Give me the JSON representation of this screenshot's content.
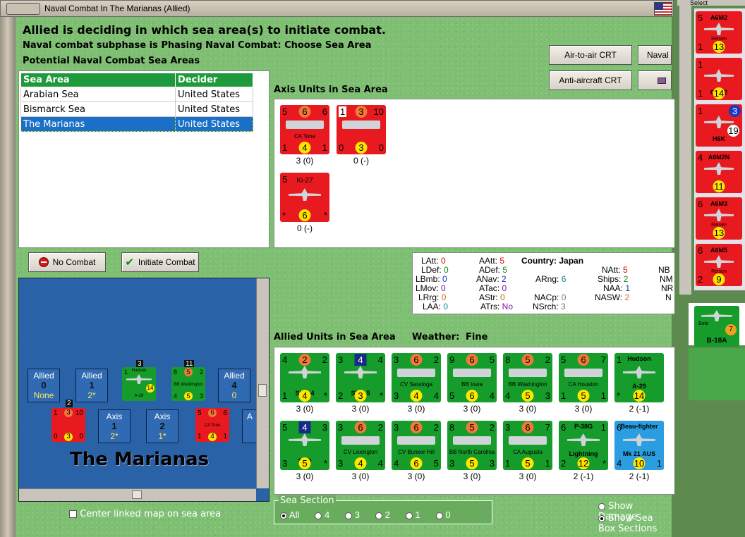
{
  "window": {
    "title": "Naval Combat In The Marianas (Allied)"
  },
  "header": {
    "line1": "Allied is deciding in which sea area(s) to initiate combat.",
    "line2": "Naval combat subphase is Phasing Naval Combat: Choose Sea Area",
    "line3": "Potential Naval Combat Sea Areas"
  },
  "sea_table": {
    "columns": [
      "Sea Area",
      "Decider"
    ],
    "rows": [
      [
        "Arabian Sea",
        "United States"
      ],
      [
        "Bismarck Sea",
        "United States"
      ],
      [
        "The Marianas",
        "United States"
      ]
    ],
    "selected_index": 2
  },
  "crt_buttons": {
    "air_to_air": "Air-to-air CRT",
    "naval": "Naval CRT",
    "anti_aircraft": "Anti-aircraft CRT"
  },
  "axis_section": {
    "label": "Axis Units in Sea Area"
  },
  "axis_units": [
    {
      "name": "CA Tone",
      "tl": "5",
      "tc": "6",
      "tr": "6",
      "bl": "1",
      "bc": "4",
      "br": "1",
      "caption": "3 (0)"
    },
    {
      "name": "",
      "tl": "1",
      "tc": "3",
      "tr": "10",
      "bl": "0",
      "bc": "3",
      "br": "0",
      "caption": "0 (-)"
    },
    {
      "name": "Ki-27",
      "tl": "5",
      "tc": "",
      "tr": "",
      "bl": "*",
      "bc": "6",
      "br": "*",
      "caption": "0 (-)"
    }
  ],
  "combat_buttons": {
    "no_combat": "No Combat",
    "initiate": "Initiate Combat"
  },
  "map": {
    "title": "The Marianas",
    "allied_boxes": [
      {
        "label": "Allied",
        "value": "0",
        "sub": "None"
      },
      {
        "label": "Allied",
        "value": "1",
        "sub": "2*"
      },
      {
        "label": "Allied",
        "value": "4",
        "sub": "0"
      }
    ],
    "axis_boxes": [
      {
        "label": "Axis",
        "value": "1",
        "sub": "2*"
      },
      {
        "label": "Axis",
        "value": "2",
        "sub": "1*"
      },
      {
        "label": "A",
        "value": "",
        "sub": ""
      }
    ],
    "stack_counts": [
      "3",
      "11",
      "2"
    ],
    "mini_counters": [
      {
        "name": "Hudson",
        "tl": "1",
        "tc": "",
        "tr": "",
        "bl": "",
        "bc": "14",
        "br": "",
        "sub": "A-29"
      },
      {
        "name": "BB Washington",
        "tl": "8",
        "tc": "5",
        "tr": "2",
        "bl": "4",
        "bc": "5",
        "br": "3"
      },
      {
        "name": "",
        "tl": "1",
        "tc": "3",
        "tr": "10",
        "bl": "0",
        "bc": "3",
        "br": "0"
      },
      {
        "name": "CA Tone",
        "tl": "5",
        "tc": "6",
        "tr": "6",
        "bl": "1",
        "bc": "4",
        "br": "1"
      }
    ]
  },
  "stats": {
    "LAtt": "0",
    "LDef": "0",
    "LBmb": "0",
    "LMov": "0",
    "LRrg": "0",
    "LAA": "0",
    "AAtt": "5",
    "ADef": "5",
    "ANav": "2",
    "ATac": "0",
    "AStr": "0",
    "ATrs": "No",
    "Country": "Japan",
    "ARng": "6",
    "NACp": "0",
    "NSrch": "3",
    "NAtt": "5",
    "Ships": "2",
    "NAA": "1",
    "NASW": "2",
    "NB_cut": "NB",
    "NM_cut": "NM",
    "NR_cut": "NR",
    "N_cut": "N",
    "labels": {
      "LAtt": "LAtt:",
      "LDef": "LDef:",
      "LBmb": "LBmb:",
      "LMov": "LMov:",
      "LRrg": "LRrg:",
      "LAA": "LAA:",
      "AAtt": "AAtt:",
      "ADef": "ADef:",
      "ANav": "ANav:",
      "ATac": "ATac:",
      "AStr": "AStr:",
      "ATrs": "ATrs:",
      "Country": "Country:",
      "ARng": "ARng:",
      "NACp": "NACp:",
      "NSrch": "NSrch:",
      "NAtt": "NAtt:",
      "Ships": "Ships:",
      "NAA": "NAA:",
      "NASW": "NASW:"
    }
  },
  "allied_section": {
    "label": "Allied Units in Sea Area",
    "weather_label": "Weather:",
    "weather": "Fine"
  },
  "allied_units": [
    {
      "name": "SBD-4",
      "tl": "4",
      "tc": "2",
      "tr": "2",
      "bl": "1",
      "bc": "4",
      "br": "*",
      "caption": "3 (0)",
      "color": "green",
      "tcColor": "#f07838"
    },
    {
      "name": "SBD-5",
      "tl": "3",
      "tc": "4",
      "tr": "4",
      "bl": "2",
      "bc": "3",
      "br": "*",
      "caption": "3 (0)",
      "color": "green",
      "tcColor": "#182a8a"
    },
    {
      "name": "CV Saratoga",
      "tl": "3",
      "tc": "6",
      "tr": "2",
      "bl": "3",
      "bc": "4",
      "br": "4",
      "caption": "3 (0)",
      "color": "green",
      "tcColor": "#f07838"
    },
    {
      "name": "BB Iowa",
      "tl": "9",
      "tc": "6",
      "tr": "5",
      "bl": "5",
      "bc": "6",
      "br": "4",
      "caption": "3 (0)",
      "color": "green",
      "tcColor": "#f07838"
    },
    {
      "name": "BB Washington",
      "tl": "8",
      "tc": "5",
      "tr": "2",
      "bl": "4",
      "bc": "5",
      "br": "3",
      "caption": "3 (0)",
      "color": "green",
      "tcColor": "#f07838"
    },
    {
      "name": "CA Houston",
      "tl": "5",
      "tc": "6",
      "tr": "7",
      "bl": "1",
      "bc": "5",
      "br": "1",
      "caption": "3 (0)",
      "color": "green",
      "tcColor": "#f07838"
    },
    {
      "name": "Hudson",
      "tl": "1",
      "tc": "",
      "tr": "",
      "bl": "*",
      "bc": "14",
      "br": "",
      "sub": "A-29",
      "caption": "2 (-1)",
      "color": "green",
      "tcColor": ""
    },
    {
      "name": "SBD",
      "tl": "5",
      "tc": "4",
      "tr": "3",
      "bl": "3",
      "bc": "5",
      "br": "*",
      "caption": "3 (0)",
      "color": "green",
      "tcColor": "#182a8a"
    },
    {
      "name": "CV Lexington",
      "tl": "3",
      "tc": "6",
      "tr": "2",
      "bl": "3",
      "bc": "4",
      "br": "4",
      "caption": "3 (0)",
      "color": "green",
      "tcColor": "#f07838"
    },
    {
      "name": "CV Bunker Hill",
      "tl": "3",
      "tc": "6",
      "tr": "2",
      "bl": "4",
      "bc": "6",
      "br": "5",
      "caption": "3 (0)",
      "color": "green",
      "tcColor": "#f07838"
    },
    {
      "name": "BB North Carolina",
      "tl": "8",
      "tc": "5",
      "tr": "2",
      "bl": "3",
      "bc": "5",
      "br": "3",
      "caption": "3 (0)",
      "color": "green",
      "tcColor": "#f07838"
    },
    {
      "name": "CA Augusta",
      "tl": "3",
      "tc": "6",
      "tr": "7",
      "bl": "1",
      "bc": "5",
      "br": "1",
      "caption": "3 (0)",
      "color": "green",
      "tcColor": "#f07838"
    },
    {
      "name": "P-38G",
      "tl": "6",
      "tc": "",
      "tr": "1",
      "bl": "2",
      "bc": "12",
      "br": "*",
      "sub": "Lightning",
      "caption": "2 (-1)",
      "color": "green",
      "tcColor": ""
    },
    {
      "name": "Beau-fighter",
      "tl": "6",
      "tc": "",
      "tr": "",
      "bl": "4",
      "bc": "10",
      "br": "1",
      "sub": "Mk 21 AUS",
      "caption": "2 (-1)",
      "color": "blue",
      "tcColor": ""
    }
  ],
  "sea_section": {
    "label": "Sea Section",
    "options": [
      "All",
      "4",
      "3",
      "2",
      "1",
      "0"
    ],
    "selected": "All"
  },
  "options": {
    "center_map": "Center linked map on sea area",
    "show_damage": "Show Damage",
    "show_sea_box": "Show Sea Box Sections"
  },
  "side_panel": {
    "label": "Select",
    "counters": [
      {
        "name": "A6M2",
        "sub": "Reisen",
        "tl": "5",
        "bl": "1",
        "bc": "13"
      },
      {
        "name": "G3M2",
        "sub": "",
        "tl": "1",
        "bl": "1",
        "bc": "14"
      },
      {
        "name": "H6K",
        "sub": "",
        "tl": "1",
        "bl": "",
        "bc": "19",
        "tr": "3"
      },
      {
        "name": "A6M2N",
        "sub": "",
        "tl": "4",
        "bl": "",
        "bc": "11"
      },
      {
        "name": "A6M3",
        "sub": "Reisen",
        "tl": "6",
        "bl": "",
        "bc": "13"
      },
      {
        "name": "A6M5",
        "sub": "Reisen",
        "tl": "6",
        "bl": "2",
        "bc": "9"
      }
    ],
    "lower": {
      "name": "B-18A",
      "sub": "Bolo",
      "tl": "",
      "bc": "7"
    }
  }
}
